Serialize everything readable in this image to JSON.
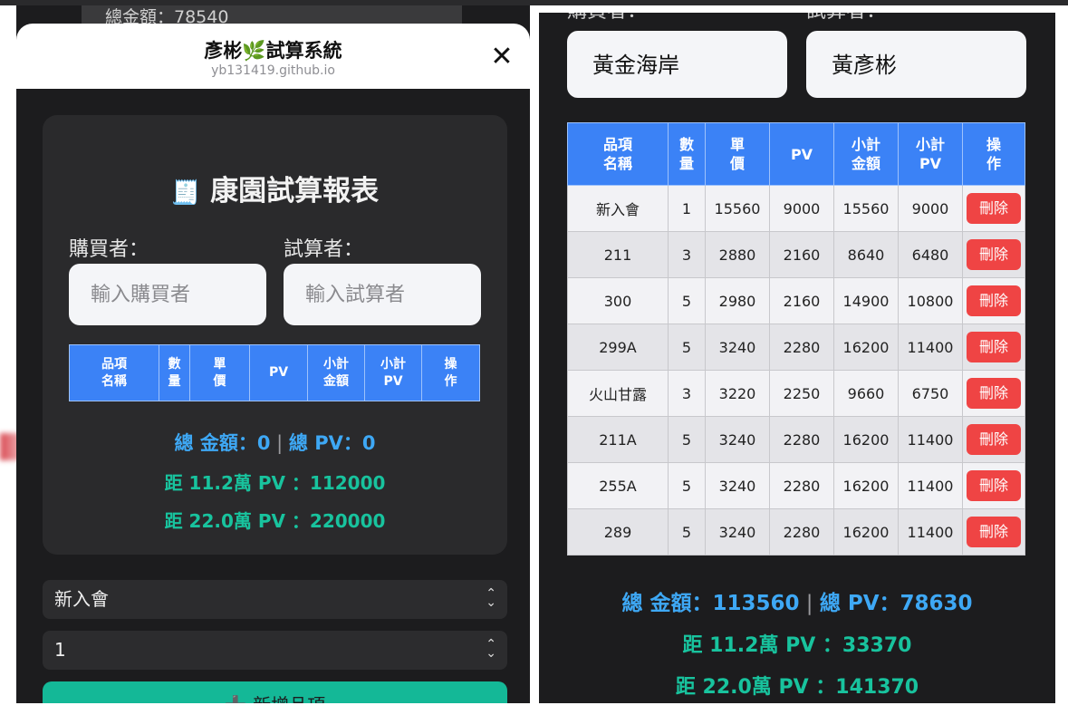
{
  "left": {
    "peek_text": "總金額：78540",
    "brand": {
      "name_a": "彥彬",
      "leaf_icon": "🌿",
      "name_b": "試算系統",
      "url": "yb131419.github.io"
    },
    "card": {
      "title_icon": "🧾",
      "title": "康園試算報表",
      "buyer_label": "購買者：",
      "calc_label": "試算者：",
      "buyer_placeholder": "輸入購買者",
      "calc_placeholder": "輸入試算者",
      "headers": [
        {
          "l1": "品項",
          "l2": "名稱"
        },
        {
          "l1": "數",
          "l2": "量"
        },
        {
          "l1": "單",
          "l2": "價"
        },
        {
          "l1": "PV",
          "l2": ""
        },
        {
          "l1": "小計",
          "l2": "金額"
        },
        {
          "l1": "小計",
          "l2": "PV"
        },
        {
          "l1": "操",
          "l2": "作"
        }
      ],
      "total_label": "總 金額：",
      "total_value": "0",
      "pv_label": "總 PV：",
      "pv_value": "0",
      "dist1": "距 11.2萬 PV ：112000",
      "dist2": "距 22.0萬 PV ：220000"
    },
    "product_select": "新入會",
    "qty_select": "1",
    "add_button": "➕ 新增品項"
  },
  "right": {
    "buyer_label": "購買者：",
    "calc_label": "試算者：",
    "buyer_value": "黃金海岸",
    "calc_value": "黃彥彬",
    "headers": [
      {
        "l1": "品項",
        "l2": "名稱"
      },
      {
        "l1": "數",
        "l2": "量"
      },
      {
        "l1": "單",
        "l2": "價"
      },
      {
        "l1": "PV",
        "l2": ""
      },
      {
        "l1": "小計",
        "l2": "金額"
      },
      {
        "l1": "小計",
        "l2": "PV"
      },
      {
        "l1": "操",
        "l2": "作"
      }
    ],
    "rows": [
      [
        "新入會",
        "1",
        "15560",
        "9000",
        "15560",
        "9000"
      ],
      [
        "211",
        "3",
        "2880",
        "2160",
        "8640",
        "6480"
      ],
      [
        "300",
        "5",
        "2980",
        "2160",
        "14900",
        "10800"
      ],
      [
        "299A",
        "5",
        "3240",
        "2280",
        "16200",
        "11400"
      ],
      [
        "火山甘露",
        "3",
        "3220",
        "2250",
        "9660",
        "6750"
      ],
      [
        "211A",
        "5",
        "3240",
        "2280",
        "16200",
        "11400"
      ],
      [
        "255A",
        "5",
        "3240",
        "2280",
        "16200",
        "11400"
      ],
      [
        "289",
        "5",
        "3240",
        "2280",
        "16200",
        "11400"
      ]
    ],
    "delete_label": "刪除",
    "total_label": "總 金額：",
    "total_value": "113560",
    "pv_label": "總 PV：",
    "pv_value": "78630",
    "dist1": "距 11.2萬 PV ：33370",
    "dist2": "距 22.0萬 PV ：141370"
  },
  "colors": {
    "header_blue": "#3b82f6",
    "total_blue": "#3ea8f5",
    "dist_green": "#18c39e",
    "delete_red": "#ef4444",
    "add_teal": "#14b897"
  }
}
